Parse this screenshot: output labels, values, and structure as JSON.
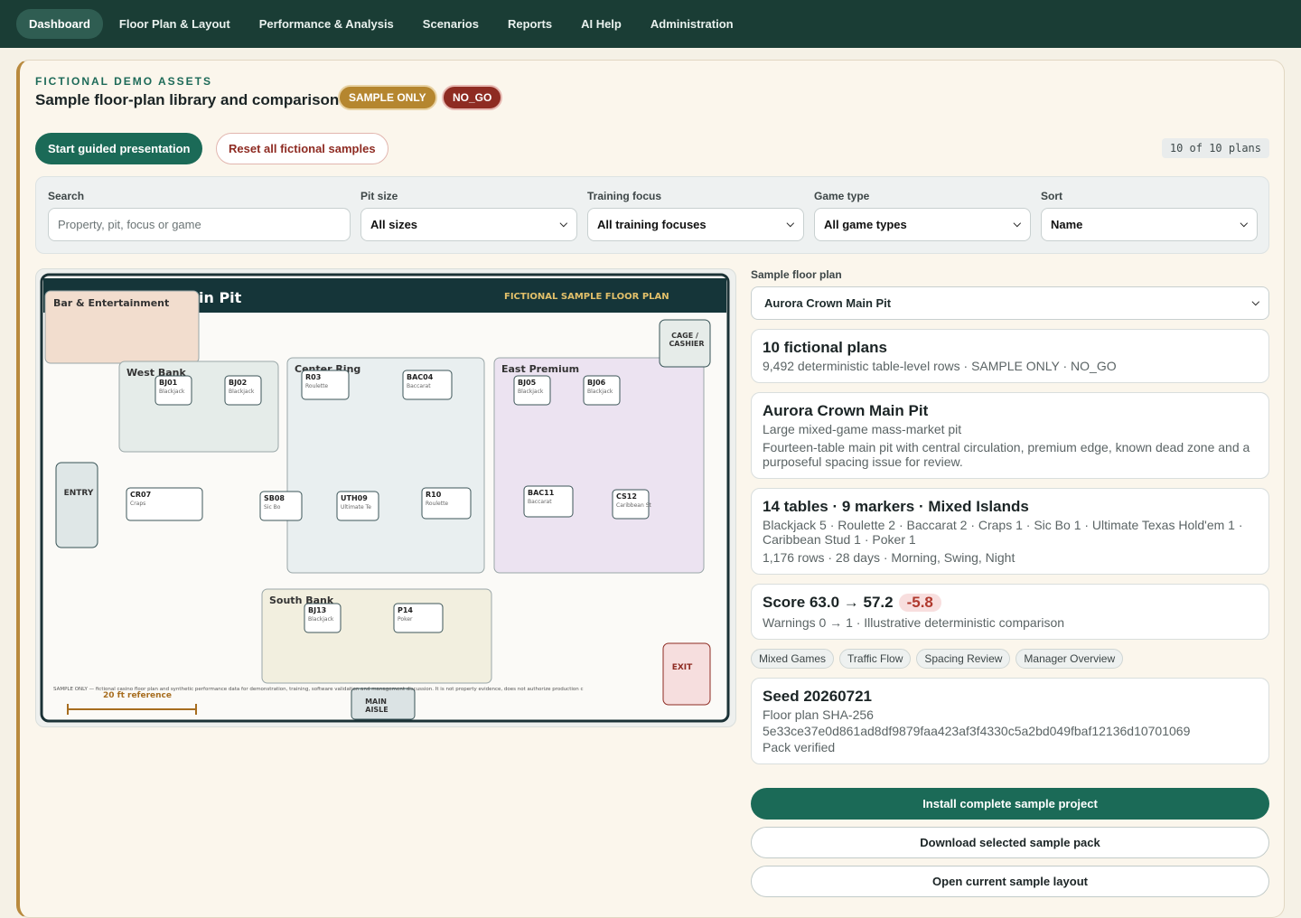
{
  "nav": [
    {
      "label": "Dashboard",
      "active": true
    },
    {
      "label": "Floor Plan & Layout"
    },
    {
      "label": "Performance & Analysis"
    },
    {
      "label": "Scenarios"
    },
    {
      "label": "Reports"
    },
    {
      "label": "AI Help"
    },
    {
      "label": "Administration"
    }
  ],
  "header": {
    "eyebrow": "FICTIONAL DEMO ASSETS",
    "title": "Sample floor-plan library and comparison",
    "badge_sample": "SAMPLE ONLY",
    "badge_nogo": "NO_GO"
  },
  "actions": {
    "start": "Start guided presentation",
    "reset": "Reset all fictional samples",
    "count": "10 of 10 plans"
  },
  "filters": {
    "search_label": "Search",
    "search_placeholder": "Property, pit, focus or game",
    "pit_label": "Pit size",
    "pit_value": "All sizes",
    "focus_label": "Training focus",
    "focus_value": "All training focuses",
    "game_label": "Game type",
    "game_value": "All game types",
    "sort_label": "Sort",
    "sort_value": "Name"
  },
  "map": {
    "title_fragment": "in Pit",
    "banner": "FICTIONAL SAMPLE FLOOR PLAN",
    "bar": "Bar & Entertainment",
    "cage": "CAGE /",
    "cage2": "CASHIER",
    "entry": "ENTRY",
    "exit": "EXIT",
    "main_aisle": "MAIN",
    "main_aisle2": "AISLE",
    "reference": "20 ft reference",
    "disclaimer": "SAMPLE ONLY — fictional casino floor plan and synthetic performance data for demonstration, training, software validation and management discussion. It is not property evidence, does not authorize production c",
    "zones": {
      "west": "West Bank",
      "center": "Center Ring",
      "east": "East Premium",
      "south": "South Bank"
    },
    "tables": [
      {
        "id": "BJ01",
        "game": "Blackjack"
      },
      {
        "id": "BJ02",
        "game": "Blackjack"
      },
      {
        "id": "R03",
        "game": "Roulette"
      },
      {
        "id": "BAC04",
        "game": "Baccarat"
      },
      {
        "id": "BJ05",
        "game": "Blackjack"
      },
      {
        "id": "BJ06",
        "game": "Blackjack"
      },
      {
        "id": "CR07",
        "game": "Craps"
      },
      {
        "id": "SB08",
        "game": "Sic Bo"
      },
      {
        "id": "UTH09",
        "game": "Ultimate Te"
      },
      {
        "id": "R10",
        "game": "Roulette"
      },
      {
        "id": "BAC11",
        "game": "Baccarat"
      },
      {
        "id": "CS12",
        "game": "Caribbean St"
      },
      {
        "id": "BJ13",
        "game": "Blackjack"
      },
      {
        "id": "P14",
        "game": "Poker"
      }
    ]
  },
  "side": {
    "label": "Sample floor plan",
    "selected": "Aurora Crown Main Pit",
    "card1_title": "10 fictional plans",
    "card1_text": "9,492 deterministic table-level rows · SAMPLE ONLY · NO_GO",
    "card2_title": "Aurora Crown Main Pit",
    "card2_sub": "Large mixed-game mass-market pit",
    "card2_text": "Fourteen-table main pit with central circulation, premium edge, known dead zone and a purposeful spacing issue for review.",
    "card3_title": "14 tables · 9 markers · Mixed Islands",
    "card3_text": "Blackjack 5 · Roulette 2 · Baccarat 2 · Craps 1 · Sic Bo 1 · Ultimate Texas Hold'em 1 · Caribbean Stud 1 · Poker 1",
    "card3_text2": "1,176 rows · 28 days · Morning, Swing, Night",
    "card4_title": "Score 63.0 → 57.2",
    "card4_delta": "-5.8",
    "card4_text": "Warnings 0 → 1 · Illustrative deterministic comparison",
    "tags": [
      "Mixed Games",
      "Traffic Flow",
      "Spacing Review",
      "Manager Overview"
    ],
    "card5_title": "Seed 20260721",
    "card5_text": "Floor plan SHA-256",
    "card5_hash": "5e33ce37e0d861ad8df9879faa423af3f4330c5a2bd049fbaf12136d10701069",
    "card5_text2": "Pack verified",
    "btn_install": "Install complete sample project",
    "btn_download": "Download selected sample pack",
    "btn_open": "Open current sample layout"
  },
  "colors": {
    "nav": "#1a3d35",
    "accent": "#1b6a57",
    "gold": "#b5862f",
    "danger": "#8e2b22"
  }
}
